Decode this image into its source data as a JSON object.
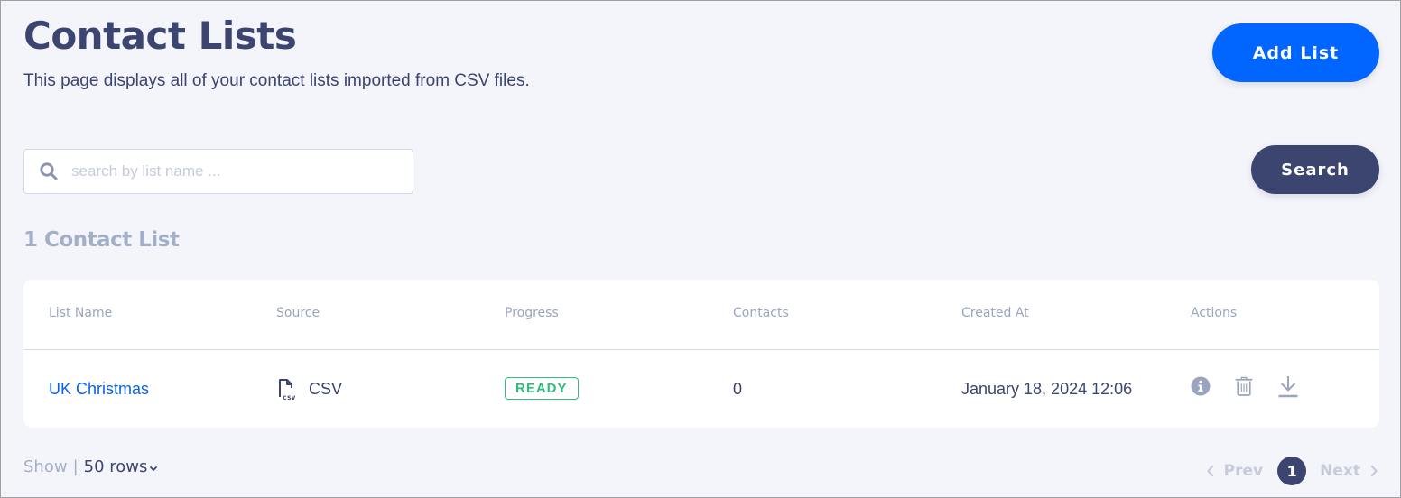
{
  "header": {
    "title": "Contact Lists",
    "subtitle": "This page displays all of your contact lists imported from CSV files.",
    "add_button": "Add List"
  },
  "search": {
    "placeholder": "search by list name ...",
    "value": "",
    "button": "Search",
    "icon": "search-icon"
  },
  "results": {
    "count_label": "1 Contact List"
  },
  "table": {
    "columns": [
      "List Name",
      "Source",
      "Progress",
      "Contacts",
      "Created At",
      "Actions"
    ],
    "rows": [
      {
        "name": "UK Christmas",
        "source": "CSV",
        "source_icon": "csv-file-icon",
        "progress": "READY",
        "contacts": "0",
        "created_at": "January 18, 2024 12:06",
        "actions": [
          "info-icon",
          "trash-icon",
          "download-icon"
        ]
      }
    ]
  },
  "footer": {
    "show_label": "Show",
    "separator": "|",
    "rows_value": "50 rows",
    "prev": "Prev",
    "next": "Next",
    "current_page": "1"
  },
  "colors": {
    "primary": "#0066ff",
    "dark": "#3c4470",
    "muted": "#a3aec7",
    "success": "#2ebd7a",
    "link": "#0a62e6",
    "background": "#f4f5fa"
  }
}
